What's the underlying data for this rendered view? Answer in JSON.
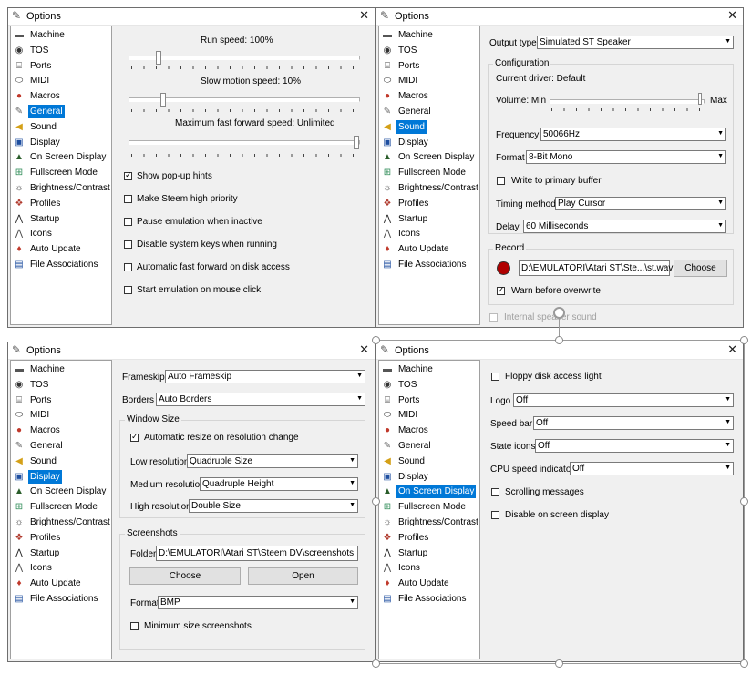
{
  "window_title": "Options",
  "icons": {
    "title": "pen-icon",
    "close": "close-icon"
  },
  "accent_color": "#0078d7",
  "sidebar_items": [
    {
      "label": "Machine",
      "icon": "machine-icon"
    },
    {
      "label": "TOS",
      "icon": "tos-icon"
    },
    {
      "label": "Ports",
      "icon": "ports-icon"
    },
    {
      "label": "MIDI",
      "icon": "midi-icon"
    },
    {
      "label": "Macros",
      "icon": "macros-icon"
    },
    {
      "label": "General",
      "icon": "general-icon"
    },
    {
      "label": "Sound",
      "icon": "sound-icon"
    },
    {
      "label": "Display",
      "icon": "display-icon"
    },
    {
      "label": "On Screen Display",
      "icon": "osd-icon"
    },
    {
      "label": "Fullscreen Mode",
      "icon": "fullscreen-icon"
    },
    {
      "label": "Brightness/Contrast",
      "icon": "brightness-icon"
    },
    {
      "label": "Profiles",
      "icon": "profiles-icon"
    },
    {
      "label": "Startup",
      "icon": "startup-icon"
    },
    {
      "label": "Icons",
      "icon": "icons-icon"
    },
    {
      "label": "Auto Update",
      "icon": "autoupdate-icon"
    },
    {
      "label": "File Associations",
      "icon": "fileassoc-icon"
    }
  ],
  "general": {
    "selected": "General",
    "run_speed_label": "Run speed: 100%",
    "run_speed_level": 0.12,
    "slow_motion_label": "Slow motion speed: 10%",
    "slow_motion_level": 0.14,
    "max_ff_label": "Maximum fast forward speed: Unlimited",
    "max_ff_level": 1.0,
    "checkboxes": [
      {
        "label": "Show pop-up hints",
        "checked": true
      },
      {
        "label": "Make Steem high priority",
        "checked": false
      },
      {
        "label": "Pause emulation when inactive",
        "checked": false
      },
      {
        "label": "Disable system keys when running",
        "checked": false
      },
      {
        "label": "Automatic fast forward on disk access",
        "checked": false
      },
      {
        "label": "Start emulation on mouse click",
        "checked": false
      }
    ]
  },
  "sound": {
    "selected": "Sound",
    "output_type_label": "Output type",
    "output_type_value": "Simulated ST Speaker",
    "configuration_group": "Configuration",
    "current_driver": "Current driver: Default",
    "volume_label": "Volume: Min",
    "volume_max": "Max",
    "volume_level": 1.0,
    "frequency_label": "Frequency",
    "frequency_value": "50066Hz",
    "format_label": "Format",
    "format_value": "8-Bit Mono",
    "write_primary_label": "Write to primary buffer",
    "write_primary_checked": false,
    "timing_label": "Timing method",
    "timing_value": "Play Cursor",
    "delay_label": "Delay",
    "delay_value": "60 Milliseconds",
    "record_group": "Record",
    "record_path": "D:\\EMULATORI\\Atari ST\\Ste...\\st.wav",
    "choose_label": "Choose",
    "warn_overwrite_label": "Warn before overwrite",
    "warn_overwrite_checked": true,
    "internal_speaker_label": "Internal speaker sound",
    "record_color": "#b00000"
  },
  "display": {
    "selected": "Display",
    "frameskip_label": "Frameskip",
    "frameskip_value": "Auto Frameskip",
    "borders_label": "Borders",
    "borders_value": "Auto Borders",
    "window_size_group": "Window Size",
    "auto_resize_label": "Automatic resize on resolution change",
    "auto_resize_checked": true,
    "low_res_label": "Low resolution",
    "low_res_value": "Quadruple Size",
    "med_res_label": "Medium resolution",
    "med_res_value": "Quadruple Height",
    "high_res_label": "High resolution",
    "high_res_value": "Double Size",
    "screenshots_group": "Screenshots",
    "folder_label": "Folder",
    "folder_value": "D:\\EMULATORI\\Atari ST\\Steem DV\\screenshots",
    "choose_label": "Choose",
    "open_label": "Open",
    "format_label": "Format",
    "format_value": "BMP",
    "min_size_label": "Minimum size screenshots",
    "min_size_checked": false
  },
  "osd": {
    "selected": "On Screen Display",
    "floppy_label": "Floppy disk access light",
    "floppy_checked": false,
    "logo_label": "Logo",
    "logo_value": "Off",
    "speed_bar_label": "Speed bar",
    "speed_bar_value": "Off",
    "state_icons_label": "State icons",
    "state_icons_value": "Off",
    "cpu_speed_label": "CPU speed indicator",
    "cpu_speed_value": "Off",
    "scrolling_label": "Scrolling messages",
    "scrolling_checked": false,
    "disable_osd_label": "Disable on screen display",
    "disable_osd_checked": false
  }
}
